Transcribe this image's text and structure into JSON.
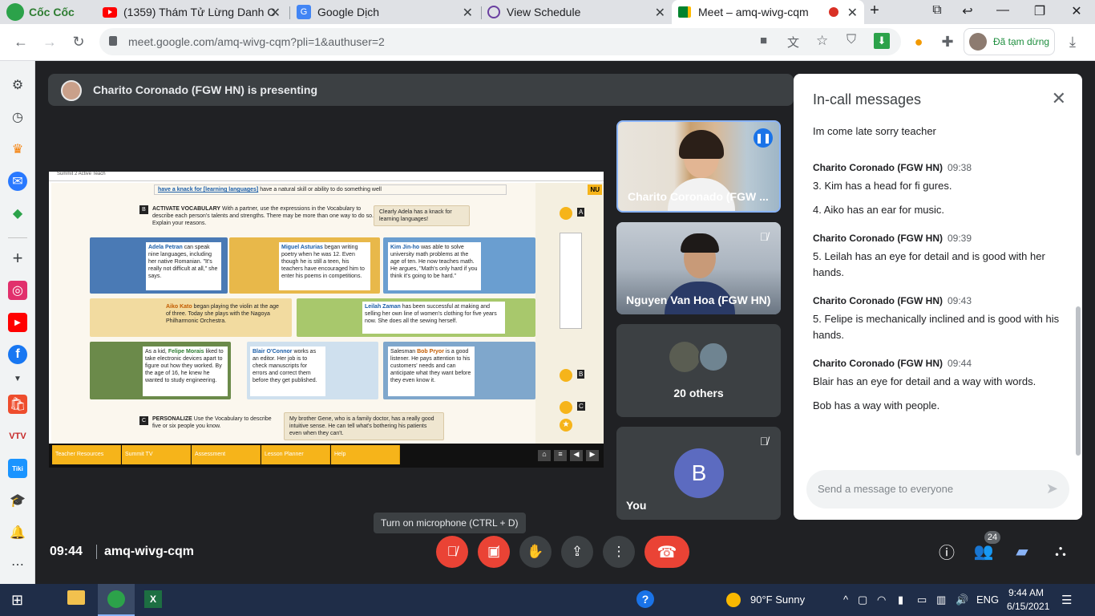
{
  "browser": {
    "tabs": [
      {
        "label": "Cốc Cốc",
        "icon": "coccoc-logo-icon"
      },
      {
        "label": "(1359) Thám Tử Lừng Danh C",
        "icon": "youtube-icon"
      },
      {
        "label": "Google Dịch",
        "icon": "google-translate-icon"
      },
      {
        "label": "View Schedule",
        "icon": "schedule-icon"
      },
      {
        "label": "Meet – amq-wivg-cqm",
        "icon": "meet-icon",
        "active": true
      }
    ],
    "url": "meet.google.com/amq-wivg-cqm?pli=1&authuser=2",
    "profile_label": "Đã tạm dừng"
  },
  "meet": {
    "presenting_text": "Charito Coronado (FGW HN) is presenting",
    "slide": {
      "window_title": "Summit 2 Active Teach",
      "top_line_highlight": "have a knack for [learning languages]",
      "top_line_text": "have a natural skill or ability to do something well",
      "section_b_letter": "B",
      "section_b_title": "ACTIVATE VOCABULARY",
      "section_b_text": "With a partner, use the expressions in the Vocabulary to describe each person's talents and strengths. There may be more than one way to do so. Explain your reasons.",
      "quote_b": "Clearly Adela has a knack for learning languages!",
      "people": [
        {
          "name": "Adela Petran",
          "text": "can speak nine languages, including her native Romanian. \"It's really not difficult at all,\" she says."
        },
        {
          "name": "Miguel Asturias",
          "text": "began writing poetry when he was 12. Even though he is still a teen, his teachers have encouraged him to enter his poems in competitions."
        },
        {
          "name": "Kim Jin-ho",
          "text": "was able to solve university math problems at the age of ten. He now teaches math. He argues, \"Math's only hard if you think it's going to be hard.\""
        },
        {
          "name": "Aiko Kato",
          "text": "began playing the violin at the age of three. Today she plays with the Nagoya Philharmonic Orchestra."
        },
        {
          "name": "Leilah Zaman",
          "text": "has been successful at making and selling her own line of women's clothing for five years now. She does all the sewing herself."
        },
        {
          "name": "Felipe Morais",
          "prefix": "As a kid,",
          "text": "liked to take electronic devices apart to figure out how they worked. By the age of 16, he knew he wanted to study engineering."
        },
        {
          "name": "Blair O'Connor",
          "text": "works as an editor. Her job is to check manuscripts for errors and correct them before they get published."
        },
        {
          "name": "Bob Pryor",
          "prefix": "Salesman",
          "text": "is a good listener. He pays attention to his customers' needs and can anticipate what they want before they even know it."
        }
      ],
      "section_c_letter": "C",
      "section_c_title": "PERSONALIZE",
      "section_c_text": "Use the Vocabulary to describe five or six people you know.",
      "quote_c": "My brother Gene, who is a family doctor, has a really good intuitive sense. He can tell what's bothering his patients even when they can't.",
      "side_tag": "NU",
      "side_letters": [
        "A",
        "B",
        "C"
      ],
      "bottom_buttons": [
        "Teacher Resources",
        "Summit TV",
        "Assessment",
        "Lesson Planner",
        "Help"
      ]
    },
    "tiles": [
      {
        "name": "Charito Coronado (FGW ...",
        "speaking": true
      },
      {
        "name": "Nguyen Van Hoa (FGW HN)",
        "muted": true
      },
      {
        "name": "20 others"
      },
      {
        "name": "You",
        "avatar_letter": "B",
        "muted": true
      }
    ],
    "chat": {
      "title": "In-call messages",
      "first_text": "Im come late sorry teacher",
      "messages": [
        {
          "sender": "Charito Coronado (FGW HN)",
          "time": "09:38",
          "texts": [
            "3. Kim has a head for fi gures.",
            "4. Aiko has an ear for music."
          ]
        },
        {
          "sender": "Charito Coronado (FGW HN)",
          "time": "09:39",
          "texts": [
            "5. Leilah has an eye for detail and is good with her hands."
          ]
        },
        {
          "sender": "Charito Coronado (FGW HN)",
          "time": "09:43",
          "texts": [
            "5. Felipe is mechanically inclined and is good with his hands."
          ]
        },
        {
          "sender": "Charito Coronado (FGW HN)",
          "time": "09:44",
          "texts": [
            "Blair has an eye for detail and a way with words.",
            "Bob has a way with people."
          ]
        }
      ],
      "input_placeholder": "Send a message to everyone"
    },
    "tooltip": "Turn on microphone (CTRL + D)",
    "clock": "09:44",
    "meeting_code": "amq-wivg-cqm",
    "participant_count": "24"
  },
  "taskbar": {
    "weather": "90°F  Sunny",
    "language": "ENG",
    "time": "9:44 AM",
    "date": "6/15/2021"
  },
  "colors": {
    "meet_bg": "#202124",
    "tile_bg": "#3c4043",
    "end_call": "#ea4335",
    "accent_blue": "#1a73e8",
    "slide_orange": "#f6b41a"
  }
}
